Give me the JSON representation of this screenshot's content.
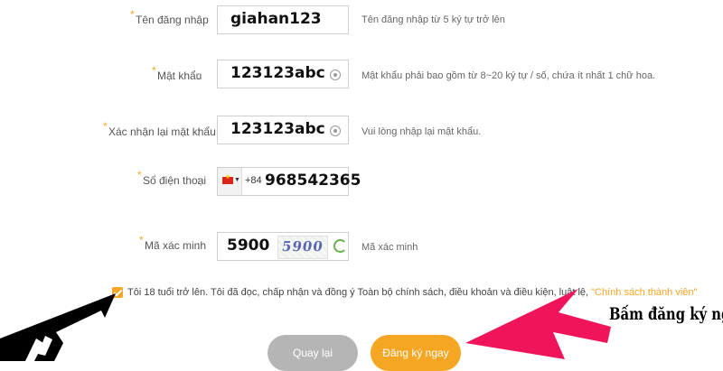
{
  "form": {
    "username": {
      "label": "Tên đăng nhập",
      "colon": ":",
      "value": "giahan123",
      "hint": "Tên đăng nhập từ 5 ký tự trở lên"
    },
    "password": {
      "label": "Mật khẩu",
      "colon": ":",
      "value": "123123abc",
      "hint": "Mật khẩu phải bao gồm từ 8~20 ký tự / số, chứa ít nhất 1 chữ hoa."
    },
    "confirm_password": {
      "label": "Xác nhận lại mật khẩu",
      "colon": ":",
      "value": "123123abc",
      "hint": "Vui lòng nhập lại mật khẩu."
    },
    "phone": {
      "label": "Số điện thoại",
      "colon": ":",
      "dial_code": "+84",
      "value": "968542365",
      "country_flag": "vietnam-flag-icon"
    },
    "captcha": {
      "label": "Mã xác minh",
      "colon": ":",
      "value": "5900",
      "image_text": "5900",
      "hint": "Mã xác minh"
    },
    "required_mark": "*"
  },
  "agreement": {
    "checked": true,
    "text": "Tôi 18 tuổi trở lên. Tôi đã đọc, chấp nhận và đồng ý Toàn bộ chính sách, điều khoản và điều kiện, luật lệ,",
    "policy_link": "\"Chính sách thành viên\""
  },
  "buttons": {
    "back": "Quay lại",
    "register": "Đăng ký ngay"
  },
  "annotation": {
    "text": "Bấm đăng ký ngay",
    "arrow_color": "#f0145a"
  },
  "colors": {
    "accent": "#f5a623",
    "back_button": "#b5b5b5",
    "captcha_text": "#5a66b4",
    "refresh": "#6ab04c"
  }
}
